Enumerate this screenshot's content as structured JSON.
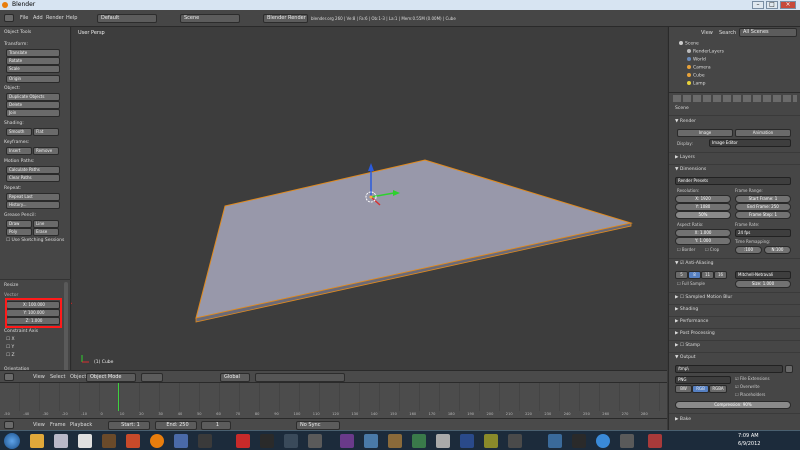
{
  "window": {
    "title": "Blender",
    "min": "–",
    "max": "□",
    "close": "×"
  },
  "infobar": {
    "menus": [
      "File",
      "Add",
      "Render",
      "Help"
    ],
    "layout": "Default",
    "scene": "Scene",
    "engine": "Blender Render",
    "stats": "blender.org 260 | Ve:8 | Fa:6 | Ob:1-3 | La:1 | Mem:0.55M (0.00M) | Cube"
  },
  "toolshelf": {
    "header": "Object Tools",
    "sections": {
      "transform": "Transform:",
      "object": "Object:",
      "shading": "Shading:",
      "keyframes": "Keyframes:",
      "motion": "Motion Paths:",
      "repeat": "Repeat:",
      "pencil": "Grease Pencil:"
    },
    "buttons": {
      "translate": "Translate",
      "rotate": "Rotate",
      "scale": "Scale",
      "origin": "Origin",
      "duplicate": "Duplicate Objects",
      "delete": "Delete",
      "join": "Join",
      "smooth": "Smooth",
      "flat": "Flat",
      "insert": "Insert",
      "remove": "Remove",
      "calc_paths": "Calculate Paths",
      "clear_paths": "Clear Paths",
      "repeat_last": "Repeat Last",
      "history": "History...",
      "draw": "Draw",
      "line": "Line",
      "poly": "Poly",
      "erase": "Erase",
      "sketch": "Use Sketching Sessions"
    },
    "resize": {
      "header": "Resize",
      "vector_label": "Vector",
      "x": "X: 100.000",
      "y": "Y: 100.000",
      "z": "Z: 1.000",
      "constraint": "Constraint Axis",
      "axes": [
        "X",
        "Y",
        "Z"
      ],
      "orientation": "Orientation"
    }
  },
  "viewport": {
    "label": "User Persp",
    "object": "(1) Cube"
  },
  "vheader": {
    "menus": [
      "View",
      "Select",
      "Object"
    ],
    "mode": "Object Mode",
    "orientation": "Global"
  },
  "timeline": {
    "ticks": [
      "-50",
      "-40",
      "-30",
      "-20",
      "-10",
      "0",
      "10",
      "20",
      "30",
      "40",
      "50",
      "60",
      "70",
      "80",
      "90",
      "100",
      "110",
      "120",
      "130",
      "140",
      "150",
      "160",
      "170",
      "180",
      "190",
      "200",
      "210",
      "220",
      "230",
      "240",
      "250",
      "260",
      "270",
      "280"
    ],
    "menus": [
      "View",
      "Frame",
      "Playback"
    ],
    "start": "Start: 1",
    "end": "End: 250",
    "current": "1",
    "sync": "No Sync"
  },
  "outliner": {
    "menus": [
      "View",
      "Search"
    ],
    "filter": "All Scenes",
    "items": [
      "Scene",
      "RenderLayers",
      "World",
      "Camera",
      "Cube",
      "Lamp"
    ]
  },
  "props": {
    "scene_label": "Scene",
    "render": {
      "header": "Render",
      "image": "Image",
      "animation": "Animation",
      "display_label": "Display:",
      "display": "Image Editor"
    },
    "layers": "Layers",
    "dimensions": {
      "header": "Dimensions",
      "presets": "Render Presets",
      "resolution": "Resolution:",
      "res_x": "X: 1920",
      "res_y": "Y: 1080",
      "res_pct": "50%",
      "frame_range": "Frame Range:",
      "start": "Start Frame: 1",
      "end": "End Frame: 250",
      "step": "Frame Step: 1",
      "aspect": "Aspect Ratio:",
      "asp_x": "X: 1.000",
      "asp_y": "Y: 1.000",
      "frame_rate": "Frame Rate:",
      "fps": "24 fps",
      "remap": "Time Remapping:",
      "old": ":100",
      "new": "N:100",
      "border": "Border",
      "crop": "Crop"
    },
    "aa": {
      "header": "Anti-Aliasing",
      "samples": [
        "5",
        "8",
        "11",
        "16"
      ],
      "filter": "Mitchell-Netravali",
      "full": "Full Sample",
      "size": "Size: 1.000"
    },
    "collapsed": [
      "Sampled Motion Blur",
      "Shading",
      "Performance",
      "Post Processing",
      "Stamp"
    ],
    "output": {
      "header": "Output",
      "path": "/tmp\\",
      "format": "PNG",
      "ext": "File Extensions",
      "overwrite": "Overwrite",
      "placeholders": "Placeholders",
      "modes": [
        "BW",
        "RGB",
        "RGBA"
      ],
      "compression": "Compression: 90%"
    },
    "bake": "Bake"
  },
  "taskbar": {
    "time": "7:09 AM",
    "date": "6/9/2012"
  },
  "annotation": {
    "color": "#ff1a1a"
  }
}
